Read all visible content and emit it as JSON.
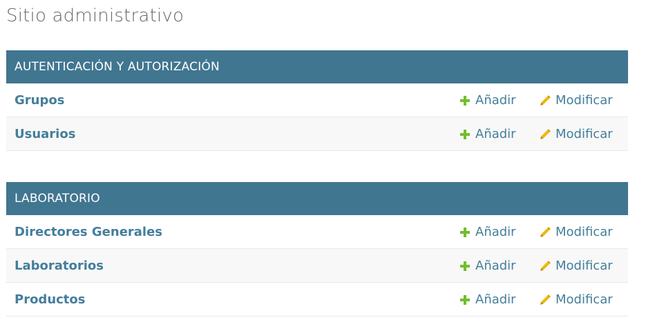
{
  "site_title": "Sitio administrativo",
  "colors": {
    "header_bg": "#417690",
    "link": "#447e9b",
    "add_icon": "#70bf2b",
    "change_icon": "#efb80b"
  },
  "modules": [
    {
      "caption": "AUTENTICACIÓN Y AUTORIZACIÓN",
      "models": [
        {
          "name": "Grupos",
          "add_label": "Añadir",
          "change_label": "Modificar"
        },
        {
          "name": "Usuarios",
          "add_label": "Añadir",
          "change_label": "Modificar"
        }
      ]
    },
    {
      "caption": "LABORATORIO",
      "models": [
        {
          "name": "Directores Generales",
          "add_label": "Añadir",
          "change_label": "Modificar"
        },
        {
          "name": "Laboratorios",
          "add_label": "Añadir",
          "change_label": "Modificar"
        },
        {
          "name": "Productos",
          "add_label": "Añadir",
          "change_label": "Modificar"
        }
      ]
    }
  ]
}
